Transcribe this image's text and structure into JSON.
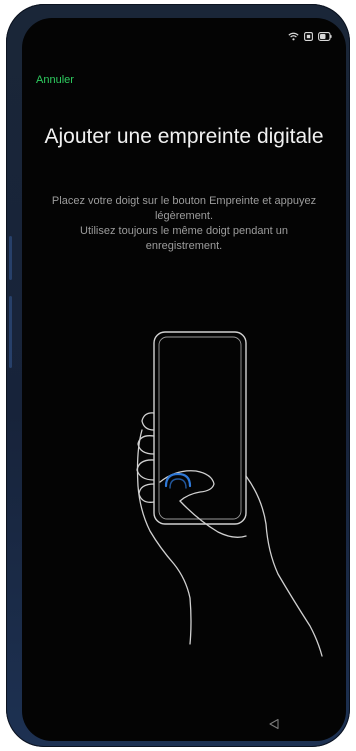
{
  "status_bar": {
    "icons": [
      "wifi-icon",
      "sim-icon",
      "battery-icon"
    ]
  },
  "header": {
    "cancel_label": "Annuler"
  },
  "main": {
    "title": "Ajouter une empreinte digitale",
    "instruction_line_1": "Placez votre doigt sur le bouton Empreinte et appuyez légèrement.",
    "instruction_line_2": "Utilisez toujours le même doigt pendant un enregistrement.",
    "illustration": "hand-holding-phone-fingerprint-illustration"
  },
  "nav_bar": {
    "back_icon": "back-triangle-icon"
  },
  "colors": {
    "accent": "#2ecc5f",
    "background": "#040404",
    "title_text": "#f1f1f1",
    "body_text": "#9c9c9c",
    "fingerprint_ring": "#2f79d8"
  }
}
